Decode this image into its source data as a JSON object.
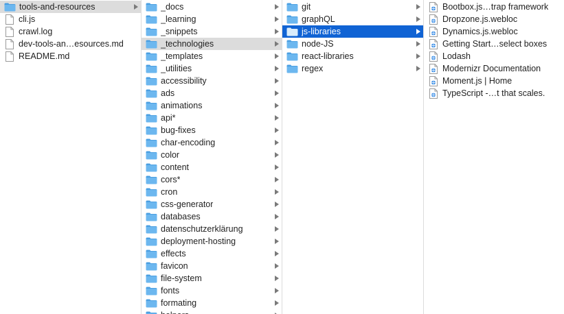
{
  "columns": [
    {
      "id": "col-1",
      "items": [
        {
          "label": "tools-and-resources",
          "kind": "folder",
          "state": "inactive"
        },
        {
          "label": "cli.js",
          "kind": "file"
        },
        {
          "label": "crawl.log",
          "kind": "file"
        },
        {
          "label": "dev-tools-an…esources.md",
          "kind": "file"
        },
        {
          "label": "README.md",
          "kind": "file"
        }
      ]
    },
    {
      "id": "col-2",
      "items": [
        {
          "label": "_docs",
          "kind": "folder"
        },
        {
          "label": "_learning",
          "kind": "folder"
        },
        {
          "label": "_snippets",
          "kind": "folder"
        },
        {
          "label": "_technologies",
          "kind": "folder",
          "state": "inactive"
        },
        {
          "label": "_templates",
          "kind": "folder"
        },
        {
          "label": "_utilities",
          "kind": "folder"
        },
        {
          "label": "accessibility",
          "kind": "folder"
        },
        {
          "label": "ads",
          "kind": "folder"
        },
        {
          "label": "animations",
          "kind": "folder"
        },
        {
          "label": "api*",
          "kind": "folder"
        },
        {
          "label": "bug-fixes",
          "kind": "folder"
        },
        {
          "label": "char-encoding",
          "kind": "folder"
        },
        {
          "label": "color",
          "kind": "folder"
        },
        {
          "label": "content",
          "kind": "folder"
        },
        {
          "label": "cors*",
          "kind": "folder"
        },
        {
          "label": "cron",
          "kind": "folder"
        },
        {
          "label": "css-generator",
          "kind": "folder"
        },
        {
          "label": "databases",
          "kind": "folder"
        },
        {
          "label": "datenschutzerklärung",
          "kind": "folder"
        },
        {
          "label": "deployment-hosting",
          "kind": "folder"
        },
        {
          "label": "effects",
          "kind": "folder"
        },
        {
          "label": "favicon",
          "kind": "folder"
        },
        {
          "label": "file-system",
          "kind": "folder"
        },
        {
          "label": "fonts",
          "kind": "folder"
        },
        {
          "label": "formating",
          "kind": "folder"
        },
        {
          "label": "helpers",
          "kind": "folder"
        }
      ]
    },
    {
      "id": "col-3",
      "items": [
        {
          "label": "git",
          "kind": "folder"
        },
        {
          "label": "graphQL",
          "kind": "folder"
        },
        {
          "label": "js-libraries",
          "kind": "folder",
          "state": "active"
        },
        {
          "label": "node-JS",
          "kind": "folder"
        },
        {
          "label": "react-libraries",
          "kind": "folder"
        },
        {
          "label": "regex",
          "kind": "folder"
        }
      ]
    },
    {
      "id": "col-4",
      "items": [
        {
          "label": "Bootbox.js…trap framework",
          "kind": "webloc"
        },
        {
          "label": "Dropzone.js.webloc",
          "kind": "webloc"
        },
        {
          "label": "Dynamics.js.webloc",
          "kind": "webloc"
        },
        {
          "label": "Getting Start…select boxes",
          "kind": "webloc"
        },
        {
          "label": "Lodash",
          "kind": "webloc"
        },
        {
          "label": "Modernizr Documentation",
          "kind": "webloc"
        },
        {
          "label": "Moment.js | Home",
          "kind": "webloc"
        },
        {
          "label": "TypeScript -…t that scales.",
          "kind": "webloc"
        }
      ]
    }
  ],
  "colors": {
    "folder_body": "#6cb7ef",
    "folder_tab": "#4a9fe2",
    "folder_body_selected": "#d9ecfb",
    "selection_active": "#1063d4",
    "selection_inactive": "#dcdcdc"
  }
}
